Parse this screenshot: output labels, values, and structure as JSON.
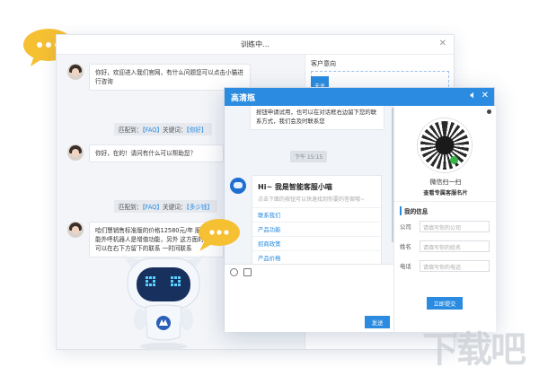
{
  "train_window": {
    "title": "训练中...",
    "close_icon": "close-icon",
    "intent_label": "客户意向",
    "intent_tag": "无关",
    "messages": [
      {
        "type": "bubble",
        "text": "你好，欢迎进入我们官网，有什么问题您可以点击小猫进行咨询"
      },
      {
        "type": "match",
        "prefix": "匹配到：",
        "faq": "【FAQ】",
        "kw_label": "关键词：",
        "kw": "【你好】"
      },
      {
        "type": "bubble",
        "text": "你好，在的！请问有什么可以帮助您？"
      },
      {
        "type": "match",
        "prefix": "匹配到：",
        "faq": "【FAQ】",
        "kw_label": "关键词：",
        "kw": "【多少钱】"
      },
      {
        "type": "bubble",
        "text": "哈们慧销售标准版的价格12580元/年 服与智能外呼机器人是增值功能，另外 这方面的需求可以在右下方留下的联系 一时间联系"
      }
    ]
  },
  "chat_window": {
    "title": "高清瓶",
    "speaker_icon": "speaker-icon",
    "close_icon": "close-icon",
    "top_bubble": "按钮申请试用，也可以在对话框右边留下您的联系方式，我们会及时联系您",
    "time": "下午 15:15",
    "bot_title": "Hi~ 我是智能客服小喵",
    "bot_sub": "点击下面的按钮可以快速找到你要的答案哦~",
    "bot_links": [
      "联系我们",
      "产品功能",
      "招商政策",
      "产品价格"
    ],
    "send_label": "发送",
    "side": {
      "qr_caption": "微信扫一扫",
      "qr_sub": "查看专属客服名片",
      "info_title": "我的信息",
      "fields": [
        {
          "label": "公司",
          "placeholder": "请填写你的公司"
        },
        {
          "label": "姓名",
          "placeholder": "请填写你的姓名"
        },
        {
          "label": "电话",
          "placeholder": "请填写你的电话"
        }
      ],
      "submit_label": "立即提交"
    }
  },
  "watermark": "下载吧",
  "colors": {
    "accent": "#2a8be0",
    "yellow": "#f6c033"
  }
}
